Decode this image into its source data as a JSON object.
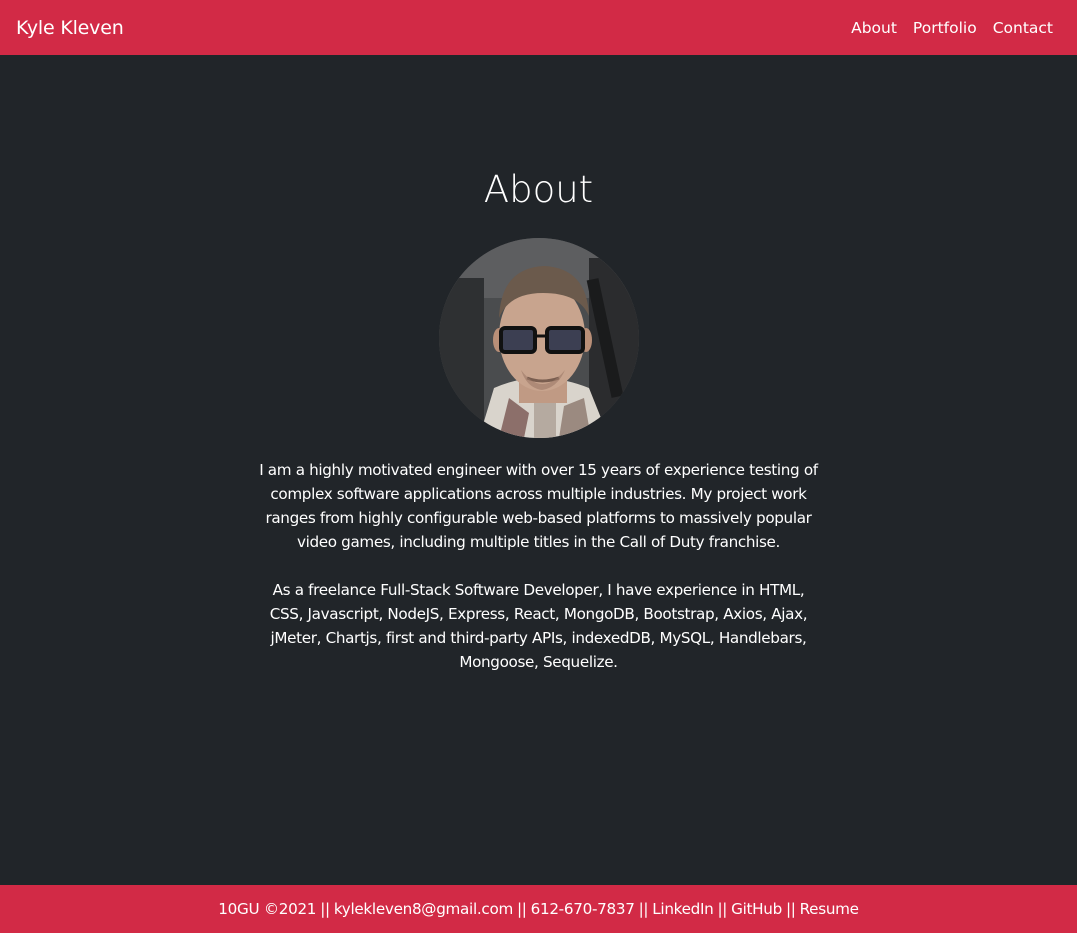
{
  "colors": {
    "accent": "#d22a46",
    "background": "#212529",
    "text": "#ffffff"
  },
  "navbar": {
    "brand": "Kyle Kleven",
    "links": [
      {
        "label": "About"
      },
      {
        "label": "Portfolio"
      },
      {
        "label": "Contact"
      }
    ]
  },
  "main": {
    "title": "About",
    "avatar_icon": "profile-photo",
    "paragraphs": [
      "I am a highly motivated engineer with over 15 years of experience testing of complex software applications across multiple industries. My project work ranges from highly configurable web-based platforms to massively popular video games, including multiple titles in the Call of Duty franchise.",
      "As a freelance Full-Stack Software Developer, I have experience in HTML, CSS, Javascript, NodeJS, Express, React, MongoDB, Bootstrap, Axios, Ajax, jMeter, Chartjs, first and third-party APIs, indexedDB, MySQL, Handlebars, Mongoose, Sequelize."
    ]
  },
  "footer": {
    "copyright": "10GU ©2021",
    "separator": "||",
    "email": "kylekleven8@gmail.com",
    "phone": "612-670-7837",
    "linkedin": "LinkedIn",
    "github": "GitHub",
    "resume": "Resume"
  }
}
